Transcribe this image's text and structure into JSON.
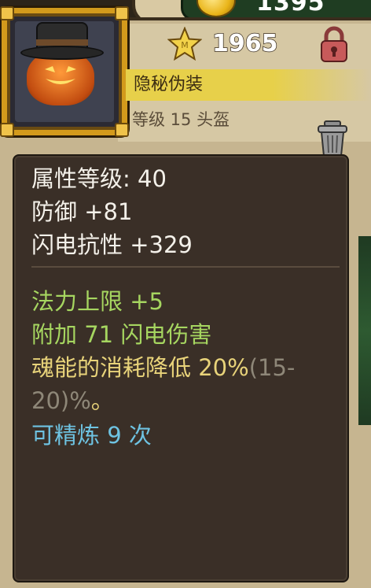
{
  "currency": {
    "amount": "1395",
    "icon": "gold-coin-icon"
  },
  "item": {
    "level_icon": "star-icon",
    "item_level": "1965",
    "name": "隐秘伪装",
    "type_line": "等级 15 头盔",
    "lock_icon": "lock-icon",
    "trash_icon": "trash-can-icon"
  },
  "stats": {
    "attribute_level": "属性等级: 40",
    "defense": "防御 +81",
    "lightning_resist": "闪电抗性 +329"
  },
  "affixes": {
    "mana_cap": "法力上限 +5",
    "lightning_damage": "附加 71 闪电伤害",
    "soul_cost_text": "魂能的消耗降低 20%",
    "soul_cost_range_a": "(15-",
    "soul_cost_range_b": "20)%",
    "soul_cost_end": "。",
    "refine": "可精炼 9 次"
  },
  "colors": {
    "panel_bg": "#3a2f27",
    "frame_gold": "#d39a1c",
    "name_bg": "#e7d04a",
    "affix_green": "#a6d660",
    "affix_yellow": "#e8d37a",
    "refine_cyan": "#6ec3e2"
  }
}
